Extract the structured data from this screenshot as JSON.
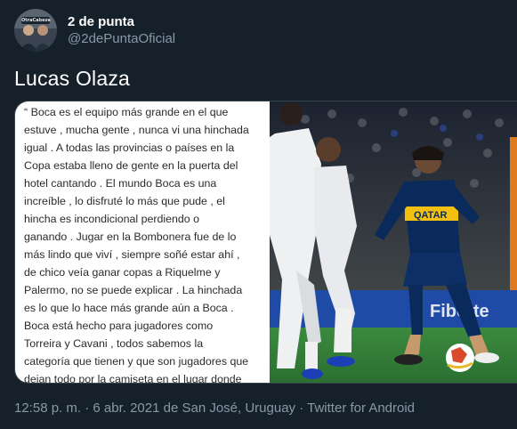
{
  "tweet": {
    "display_name": "2 de punta",
    "handle": "@2dePuntaOficial",
    "avatar_label": "OtraCabeza",
    "text": "Lucas Olaza",
    "media": {
      "quote": "“ Boca es el equipo más grande en el que\nestuve , mucha gente , nunca vi una hinchada\nigual . A todas las provincias o países en la\nCopa estaba lleno de gente en la puerta del\nhotel cantando . El mundo Boca es una\nincreíble , lo disfruté lo más que pude , el\nhincha es incondicional perdiendo o\nganando . Jugar en la Bombonera fue de lo\nmás lindo que viví , siempre soñé estar ahí ,\nde chico veía ganar copas a Riquelme y\nPalermo,  no se puede explicar . La hinchada\nes lo que lo hace más grande aún a Boca .\nBoca está hecho para jugadores como\nTorreira y Cavani , todos sabemos la\ncategoría que tienen y que son jugadores que\ndejan todo por la camiseta en el lugar donde\nestán . A la gente de Boca le encantan esos\njugadores, me gustaría verlos ahí  “ Lucas\nOlaza",
      "shirt_sponsor": "QATAR",
      "board_text": "Fiberte"
    },
    "time": "12:58 p. m.",
    "separator": "·",
    "date_location": "6 abr. 2021 de San José, Uruguay",
    "source": "Twitter for Android"
  },
  "colors": {
    "background": "#15202b",
    "secondary_text": "#8899a6",
    "border": "#38444d",
    "boca_blue": "#0b2a5c",
    "boca_gold": "#f2c10f",
    "pitch_green": "#2f7d3a"
  }
}
